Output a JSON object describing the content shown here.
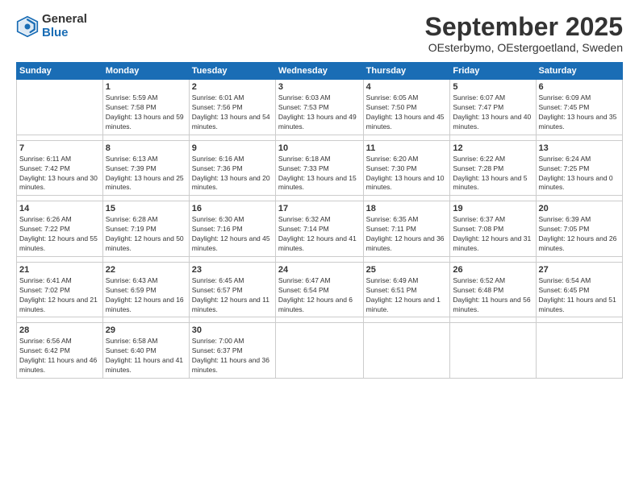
{
  "header": {
    "logo_general": "General",
    "logo_blue": "Blue",
    "title": "September 2025",
    "subtitle": "OEsterbymo, OEstergoetland, Sweden"
  },
  "weekdays": [
    "Sunday",
    "Monday",
    "Tuesday",
    "Wednesday",
    "Thursday",
    "Friday",
    "Saturday"
  ],
  "weeks": [
    [
      {
        "day": "",
        "sunrise": "",
        "sunset": "",
        "daylight": ""
      },
      {
        "day": "1",
        "sunrise": "Sunrise: 5:59 AM",
        "sunset": "Sunset: 7:58 PM",
        "daylight": "Daylight: 13 hours and 59 minutes."
      },
      {
        "day": "2",
        "sunrise": "Sunrise: 6:01 AM",
        "sunset": "Sunset: 7:56 PM",
        "daylight": "Daylight: 13 hours and 54 minutes."
      },
      {
        "day": "3",
        "sunrise": "Sunrise: 6:03 AM",
        "sunset": "Sunset: 7:53 PM",
        "daylight": "Daylight: 13 hours and 49 minutes."
      },
      {
        "day": "4",
        "sunrise": "Sunrise: 6:05 AM",
        "sunset": "Sunset: 7:50 PM",
        "daylight": "Daylight: 13 hours and 45 minutes."
      },
      {
        "day": "5",
        "sunrise": "Sunrise: 6:07 AM",
        "sunset": "Sunset: 7:47 PM",
        "daylight": "Daylight: 13 hours and 40 minutes."
      },
      {
        "day": "6",
        "sunrise": "Sunrise: 6:09 AM",
        "sunset": "Sunset: 7:45 PM",
        "daylight": "Daylight: 13 hours and 35 minutes."
      }
    ],
    [
      {
        "day": "7",
        "sunrise": "Sunrise: 6:11 AM",
        "sunset": "Sunset: 7:42 PM",
        "daylight": "Daylight: 13 hours and 30 minutes."
      },
      {
        "day": "8",
        "sunrise": "Sunrise: 6:13 AM",
        "sunset": "Sunset: 7:39 PM",
        "daylight": "Daylight: 13 hours and 25 minutes."
      },
      {
        "day": "9",
        "sunrise": "Sunrise: 6:16 AM",
        "sunset": "Sunset: 7:36 PM",
        "daylight": "Daylight: 13 hours and 20 minutes."
      },
      {
        "day": "10",
        "sunrise": "Sunrise: 6:18 AM",
        "sunset": "Sunset: 7:33 PM",
        "daylight": "Daylight: 13 hours and 15 minutes."
      },
      {
        "day": "11",
        "sunrise": "Sunrise: 6:20 AM",
        "sunset": "Sunset: 7:30 PM",
        "daylight": "Daylight: 13 hours and 10 minutes."
      },
      {
        "day": "12",
        "sunrise": "Sunrise: 6:22 AM",
        "sunset": "Sunset: 7:28 PM",
        "daylight": "Daylight: 13 hours and 5 minutes."
      },
      {
        "day": "13",
        "sunrise": "Sunrise: 6:24 AM",
        "sunset": "Sunset: 7:25 PM",
        "daylight": "Daylight: 13 hours and 0 minutes."
      }
    ],
    [
      {
        "day": "14",
        "sunrise": "Sunrise: 6:26 AM",
        "sunset": "Sunset: 7:22 PM",
        "daylight": "Daylight: 12 hours and 55 minutes."
      },
      {
        "day": "15",
        "sunrise": "Sunrise: 6:28 AM",
        "sunset": "Sunset: 7:19 PM",
        "daylight": "Daylight: 12 hours and 50 minutes."
      },
      {
        "day": "16",
        "sunrise": "Sunrise: 6:30 AM",
        "sunset": "Sunset: 7:16 PM",
        "daylight": "Daylight: 12 hours and 45 minutes."
      },
      {
        "day": "17",
        "sunrise": "Sunrise: 6:32 AM",
        "sunset": "Sunset: 7:14 PM",
        "daylight": "Daylight: 12 hours and 41 minutes."
      },
      {
        "day": "18",
        "sunrise": "Sunrise: 6:35 AM",
        "sunset": "Sunset: 7:11 PM",
        "daylight": "Daylight: 12 hours and 36 minutes."
      },
      {
        "day": "19",
        "sunrise": "Sunrise: 6:37 AM",
        "sunset": "Sunset: 7:08 PM",
        "daylight": "Daylight: 12 hours and 31 minutes."
      },
      {
        "day": "20",
        "sunrise": "Sunrise: 6:39 AM",
        "sunset": "Sunset: 7:05 PM",
        "daylight": "Daylight: 12 hours and 26 minutes."
      }
    ],
    [
      {
        "day": "21",
        "sunrise": "Sunrise: 6:41 AM",
        "sunset": "Sunset: 7:02 PM",
        "daylight": "Daylight: 12 hours and 21 minutes."
      },
      {
        "day": "22",
        "sunrise": "Sunrise: 6:43 AM",
        "sunset": "Sunset: 6:59 PM",
        "daylight": "Daylight: 12 hours and 16 minutes."
      },
      {
        "day": "23",
        "sunrise": "Sunrise: 6:45 AM",
        "sunset": "Sunset: 6:57 PM",
        "daylight": "Daylight: 12 hours and 11 minutes."
      },
      {
        "day": "24",
        "sunrise": "Sunrise: 6:47 AM",
        "sunset": "Sunset: 6:54 PM",
        "daylight": "Daylight: 12 hours and 6 minutes."
      },
      {
        "day": "25",
        "sunrise": "Sunrise: 6:49 AM",
        "sunset": "Sunset: 6:51 PM",
        "daylight": "Daylight: 12 hours and 1 minute."
      },
      {
        "day": "26",
        "sunrise": "Sunrise: 6:52 AM",
        "sunset": "Sunset: 6:48 PM",
        "daylight": "Daylight: 11 hours and 56 minutes."
      },
      {
        "day": "27",
        "sunrise": "Sunrise: 6:54 AM",
        "sunset": "Sunset: 6:45 PM",
        "daylight": "Daylight: 11 hours and 51 minutes."
      }
    ],
    [
      {
        "day": "28",
        "sunrise": "Sunrise: 6:56 AM",
        "sunset": "Sunset: 6:42 PM",
        "daylight": "Daylight: 11 hours and 46 minutes."
      },
      {
        "day": "29",
        "sunrise": "Sunrise: 6:58 AM",
        "sunset": "Sunset: 6:40 PM",
        "daylight": "Daylight: 11 hours and 41 minutes."
      },
      {
        "day": "30",
        "sunrise": "Sunrise: 7:00 AM",
        "sunset": "Sunset: 6:37 PM",
        "daylight": "Daylight: 11 hours and 36 minutes."
      },
      {
        "day": "",
        "sunrise": "",
        "sunset": "",
        "daylight": ""
      },
      {
        "day": "",
        "sunrise": "",
        "sunset": "",
        "daylight": ""
      },
      {
        "day": "",
        "sunrise": "",
        "sunset": "",
        "daylight": ""
      },
      {
        "day": "",
        "sunrise": "",
        "sunset": "",
        "daylight": ""
      }
    ]
  ]
}
